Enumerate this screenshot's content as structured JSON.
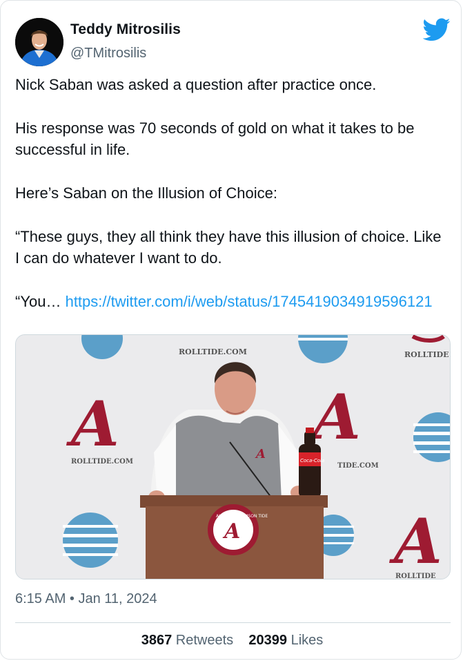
{
  "author": {
    "name": "Teddy Mitrosilis",
    "handle": "@TMitrosilis"
  },
  "brand_icon": "twitter-bird-icon",
  "tweet": {
    "line1": "Nick Saban was asked a question after practice once.",
    "line2": "His response was 70 seconds of gold on what it takes to be successful in life.",
    "line3": "Here’s Saban on the Illusion of Choice:",
    "line4": "“These guys, they all think they have this illusion of choice. Like I can do whatever I want to do.",
    "line5_prefix": "“You… ",
    "link_text": "https://twitter.com/i/web/status/1745419034919596121"
  },
  "media": {
    "backdrop_text_1": "ROLLTIDE.COM",
    "backdrop_text_2": "ROLLTIDE",
    "backdrop_text_3": "ROLLTIDE.COM",
    "backdrop_text_4": "TIDE.COM",
    "backdrop_text_5": "ROLLTIDE",
    "podium_seal_text": "ALABAMA CRIMSON TIDE",
    "bottle_label": "Coca-Cola"
  },
  "timestamp": "6:15 AM • Jan 11, 2024",
  "stats": {
    "retweets_count": "3867",
    "retweets_label": "Retweets",
    "likes_count": "20399",
    "likes_label": "Likes"
  },
  "colors": {
    "link": "#1d9bf0",
    "secondary_text": "#536471",
    "primary_text": "#0f1419",
    "crimson": "#9e1b32"
  }
}
